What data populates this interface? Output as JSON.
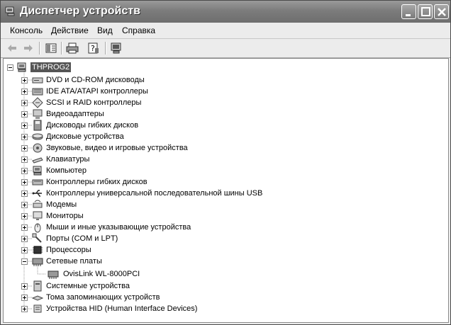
{
  "window": {
    "title": "Диспетчер устройств"
  },
  "menu": {
    "items": [
      "Консоль",
      "Действие",
      "Вид",
      "Справка"
    ]
  },
  "tree": {
    "root": "THPROG2",
    "categories": [
      {
        "label": "DVD и CD-ROM дисководы",
        "icon": "dvd-drive-icon"
      },
      {
        "label": "IDE ATA/ATAPI контроллеры",
        "icon": "ide-controller-icon"
      },
      {
        "label": "SCSI и RAID контроллеры",
        "icon": "scsi-controller-icon"
      },
      {
        "label": "Видеоадаптеры",
        "icon": "video-adapter-icon"
      },
      {
        "label": "Дисководы гибких дисков",
        "icon": "floppy-drive-icon"
      },
      {
        "label": "Дисковые устройства",
        "icon": "disk-drive-icon"
      },
      {
        "label": "Звуковые, видео и игровые устройства",
        "icon": "sound-device-icon"
      },
      {
        "label": "Клавиатуры",
        "icon": "keyboard-icon"
      },
      {
        "label": "Компьютер",
        "icon": "computer-icon"
      },
      {
        "label": "Контроллеры гибких дисков",
        "icon": "floppy-controller-icon"
      },
      {
        "label": "Контроллеры универсальной последовательной шины USB",
        "icon": "usb-icon"
      },
      {
        "label": "Модемы",
        "icon": "modem-icon"
      },
      {
        "label": "Мониторы",
        "icon": "monitor-icon"
      },
      {
        "label": "Мыши и иные указывающие устройства",
        "icon": "mouse-icon"
      },
      {
        "label": "Порты (COM и LPT)",
        "icon": "port-icon"
      },
      {
        "label": "Процессоры",
        "icon": "processor-icon"
      },
      {
        "label": "Сетевые платы",
        "icon": "network-card-icon",
        "expanded": true,
        "children": [
          {
            "label": "OvisLink WL-8000PCI",
            "icon": "network-card-icon"
          }
        ]
      },
      {
        "label": "Системные устройства",
        "icon": "system-device-icon"
      },
      {
        "label": "Тома запоминающих устройств",
        "icon": "storage-volume-icon"
      },
      {
        "label": "Устройства HID (Human Interface Devices)",
        "icon": "hid-device-icon"
      }
    ]
  }
}
